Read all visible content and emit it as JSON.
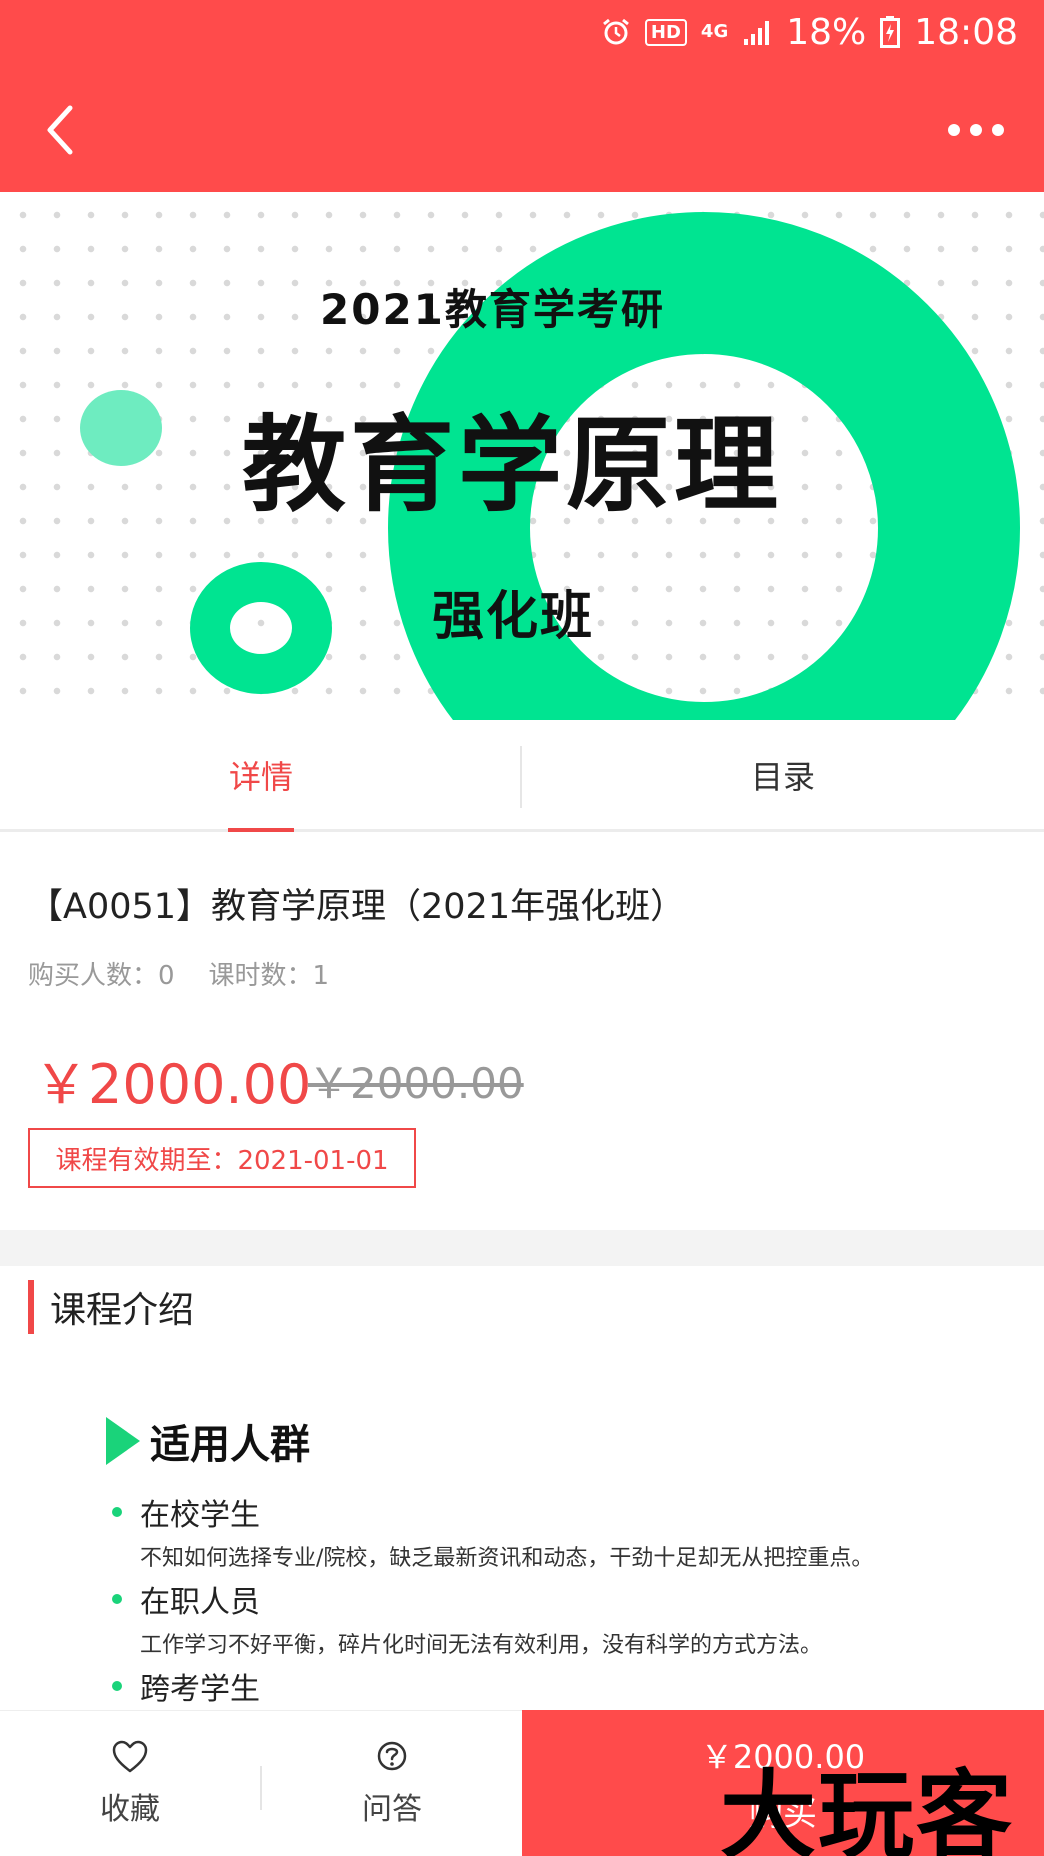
{
  "status_bar": {
    "network": "4G",
    "hd": "HD",
    "battery": "18%",
    "time": "18:08"
  },
  "banner": {
    "subtitle": "2021教育学考研",
    "title": "教育学原理",
    "class_name": "强化班"
  },
  "tabs": [
    {
      "label": "详情",
      "active": true
    },
    {
      "label": "目录",
      "active": false
    }
  ],
  "course": {
    "title": "【A0051】教育学原理（2021年强化班）",
    "buyers": "购买人数：0",
    "lessons": "课时数：1",
    "price": "￥2000.00",
    "original_price": "￥2000.00",
    "expiry": "课程有效期至：2021-01-01"
  },
  "intro": {
    "section_title": "课程介绍",
    "heading": "适用人群",
    "audience": [
      {
        "name": "在校学生",
        "desc": "不知如何选择专业/院校，缺乏最新资讯和动态，干劲十足却无从把控重点。"
      },
      {
        "name": "在职人员",
        "desc": "工作学习不好平衡，碎片化时间无法有效利用，没有科学的方式方法。"
      },
      {
        "name": "跨考学生",
        "desc": ""
      }
    ]
  },
  "bottom_bar": {
    "favorite_label": "收藏",
    "qa_label": "问答",
    "buy_price": "￥2000.00",
    "buy_label": "购买"
  },
  "watermark": "大玩客",
  "colors": {
    "brand_red": "#ff4b4b",
    "accent_red": "#f04848",
    "banner_green": "#00e491",
    "bullet_green": "#1ad37a"
  }
}
